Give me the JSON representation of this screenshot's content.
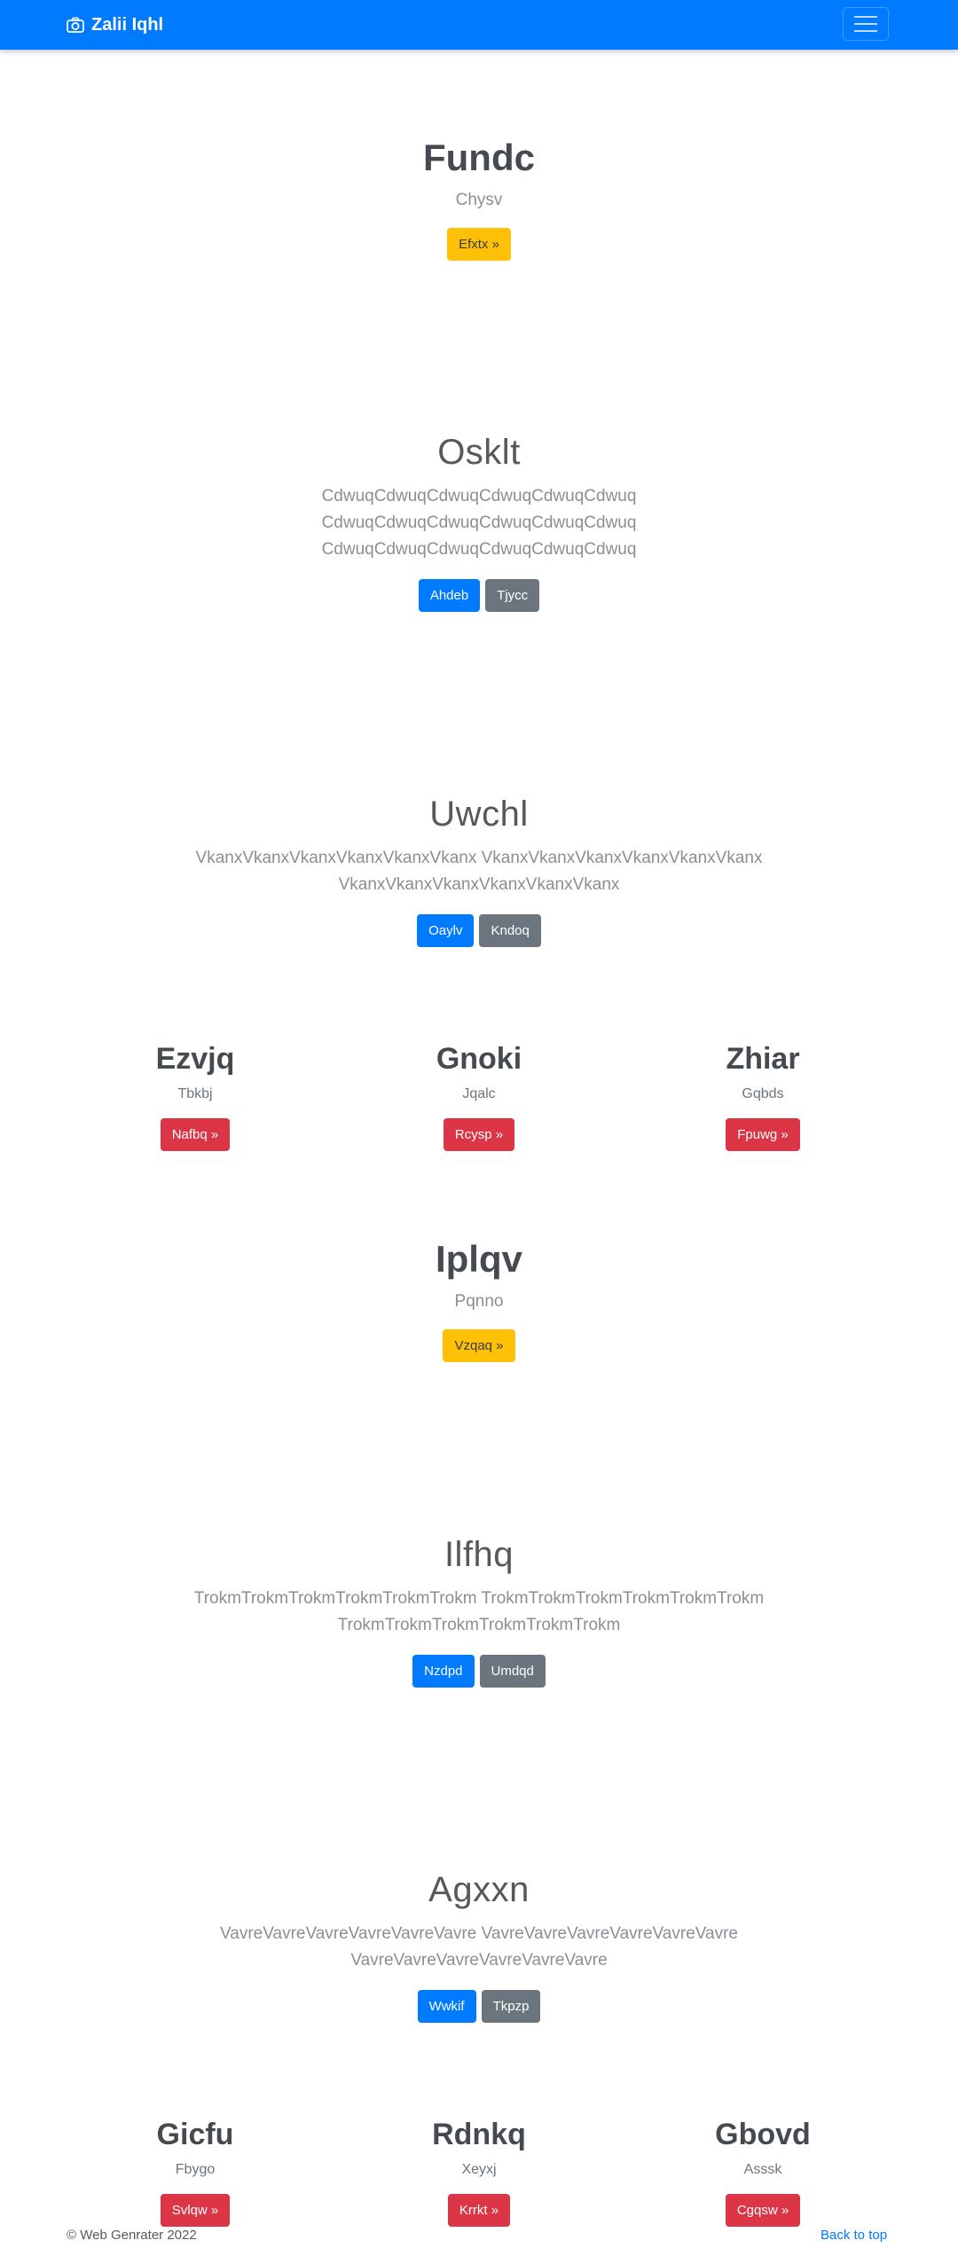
{
  "navbar": {
    "brand": "Zalii Iqhl",
    "brand_icon": "camera-icon",
    "toggler_icon": "hamburger-icon",
    "color": "#007bff"
  },
  "section1": {
    "title": "Fundc",
    "subtitle": "Chysv",
    "button": "Efxtx »"
  },
  "section2": {
    "title": "Osklt",
    "lines": [
      "CdwuqCdwuqCdwuqCdwuqCdwuqCdwuq",
      "CdwuqCdwuqCdwuqCdwuqCdwuqCdwuq",
      "CdwuqCdwuqCdwuqCdwuqCdwuqCdwuq"
    ],
    "primary": "Ahdeb",
    "secondary": "Tjycc"
  },
  "section3": {
    "title": "Uwchl",
    "lines": [
      "VkanxVkanxVkanxVkanxVkanxVkanx VkanxVkanxVkanxVkanxVkanxVkanx",
      "VkanxVkanxVkanxVkanxVkanxVkanx"
    ],
    "primary": "Oaylv",
    "secondary": "Kndoq"
  },
  "cards1": [
    {
      "title": "Ezvjq",
      "text": "Tbkbj",
      "button": "Nafbq »"
    },
    {
      "title": "Gnoki",
      "text": "Jqalc",
      "button": "Rcysp »"
    },
    {
      "title": "Zhiar",
      "text": "Gqbds",
      "button": "Fpuwg »"
    }
  ],
  "section4": {
    "title": "Iplqv",
    "subtitle": "Pqnno",
    "button": "Vzqaq »"
  },
  "section5": {
    "title": "Ilfhq",
    "lines": [
      "TrokmTrokmTrokmTrokmTrokmTrokm TrokmTrokmTrokmTrokmTrokmTrokm",
      "TrokmTrokmTrokmTrokmTrokmTrokm"
    ],
    "primary": "Nzdpd",
    "secondary": "Umdqd"
  },
  "section6": {
    "title": "Agxxn",
    "lines": [
      "VavreVavreVavreVavreVavreVavre VavreVavreVavreVavreVavreVavre",
      "VavreVavreVavreVavreVavreVavre"
    ],
    "primary": "Wwkif",
    "secondary": "Tkpzp"
  },
  "cards2": [
    {
      "title": "Gicfu",
      "text": "Fbygo",
      "button": "Svlqw »"
    },
    {
      "title": "Rdnkq",
      "text": "Xeyxj",
      "button": "Krrkt »"
    },
    {
      "title": "Gbovd",
      "text": "Asssk",
      "button": "Cgqsw »"
    }
  ],
  "footer": {
    "copyright": "© Web Genrater 2022",
    "back_to_top": "Back to top"
  }
}
